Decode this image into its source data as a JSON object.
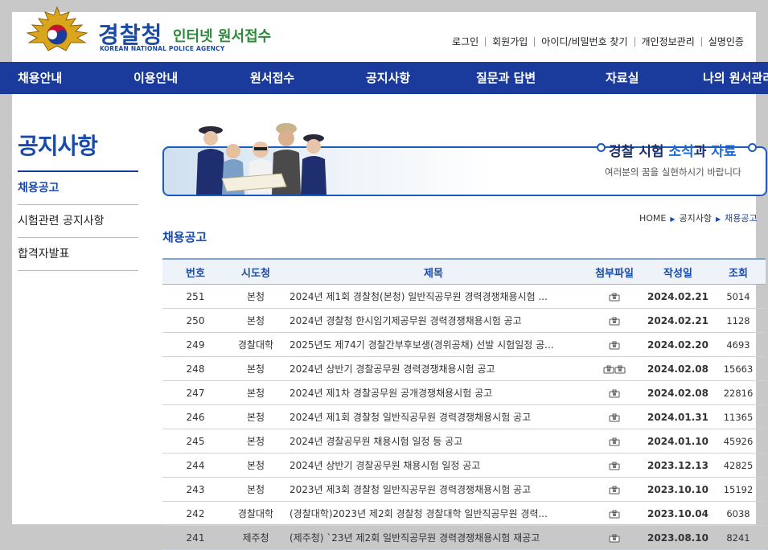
{
  "header": {
    "title": "경찰청",
    "subtitle": "인터넷 원서접수",
    "english": "KOREAN NATIONAL POLICE AGENCY",
    "util_links": [
      "로그인",
      "회원가입",
      "아이디/비밀번호 찾기",
      "개인정보관리",
      "실명인증"
    ]
  },
  "nav": {
    "items": [
      "채용안내",
      "이용안내",
      "원서접수",
      "공지사항",
      "질문과 답변",
      "자료실",
      "나의 원서관리"
    ]
  },
  "sidebar": {
    "title": "공지사항",
    "items": [
      {
        "label": "채용공고",
        "active": true
      },
      {
        "label": "시험관련 공지사항",
        "active": false
      },
      {
        "label": "합격자발표",
        "active": false
      }
    ]
  },
  "banner": {
    "line1_a": "경찰 시험 ",
    "line1_b": "소식",
    "line1_c": "과 ",
    "line1_d": "자료",
    "line2": "여러분의 꿈을 실현하시기 바랍니다"
  },
  "breadcrumb": [
    "HOME",
    "공지사항",
    "채용공고"
  ],
  "heading": "채용공고",
  "table": {
    "headers": [
      "번호",
      "시도청",
      "제목",
      "첨부파일",
      "작성일",
      "조회"
    ],
    "rows": [
      {
        "no": "251",
        "org": "본청",
        "title": "2024년 제1회 경찰청(본청) 일반직공무원 경력경쟁채용시험 ...",
        "files": 1,
        "date": "2024.02.21",
        "views": "5014"
      },
      {
        "no": "250",
        "org": "본청",
        "title": "2024년 경찰청 한시임기제공무원 경력경쟁채용시험 공고",
        "files": 1,
        "date": "2024.02.21",
        "views": "1128"
      },
      {
        "no": "249",
        "org": "경찰대학",
        "title": "2025년도 제74기 경찰간부후보생(경위공채) 선발 시험일정 공...",
        "files": 1,
        "date": "2024.02.20",
        "views": "4693"
      },
      {
        "no": "248",
        "org": "본청",
        "title": "2024년 상반기 경찰공무원 경력경쟁채용시험 공고",
        "files": 2,
        "date": "2024.02.08",
        "views": "15663"
      },
      {
        "no": "247",
        "org": "본청",
        "title": "2024년 제1차 경찰공무원 공개경쟁채용시험 공고",
        "files": 1,
        "date": "2024.02.08",
        "views": "22816"
      },
      {
        "no": "246",
        "org": "본청",
        "title": "2024년 제1회 경찰청 일반직공무원 경력경쟁채용시험 공고",
        "files": 1,
        "date": "2024.01.31",
        "views": "11365"
      },
      {
        "no": "245",
        "org": "본청",
        "title": "2024년 경찰공무원 채용시험 일정 등 공고",
        "files": 1,
        "date": "2024.01.10",
        "views": "45926"
      },
      {
        "no": "244",
        "org": "본청",
        "title": "2024년 상반기 경찰공무원 채용시험 일정 공고",
        "files": 1,
        "date": "2023.12.13",
        "views": "42825"
      },
      {
        "no": "243",
        "org": "본청",
        "title": "2023년 제3회 경찰청 일반직공무원 경력경쟁채용시험 공고",
        "files": 1,
        "date": "2023.10.10",
        "views": "15192"
      },
      {
        "no": "242",
        "org": "경찰대학",
        "title": "(경찰대학)2023년 제2회 경찰청 경찰대학 일반직공무원 경력...",
        "files": 1,
        "date": "2023.10.04",
        "views": "6038"
      },
      {
        "no": "241",
        "org": "제주청",
        "title": "(제주청) `23년 제2회 일반직공무원 경력경쟁채용시험 재공고",
        "files": 1,
        "date": "2023.08.10",
        "views": "8241"
      }
    ]
  },
  "colors": {
    "brand_blue": "#1a3a9c",
    "accent_blue": "#1a4aa8",
    "green": "#2d8a3a"
  }
}
